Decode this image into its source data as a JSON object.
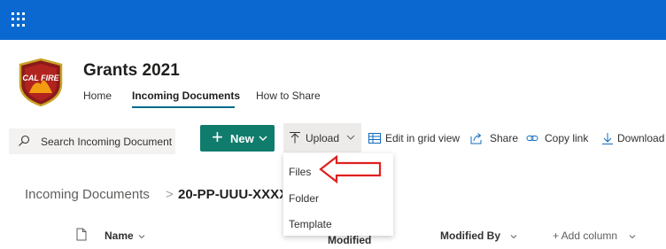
{
  "suite_bar": {
    "app_launcher_icon": "waffle-icon",
    "color": "#0a68d0"
  },
  "site": {
    "logo_icon": "cal-fire-logo",
    "logo_text": "CAL FIRE",
    "title": "Grants 2021",
    "nav": [
      {
        "label": "Home",
        "selected": false
      },
      {
        "label": "Incoming Documents",
        "selected": true
      },
      {
        "label": "How to Share",
        "selected": false
      }
    ]
  },
  "command_bar": {
    "search_placeholder": "Search Incoming Document",
    "new_label": "New",
    "upload_label": "Upload",
    "edit_grid_label": "Edit in grid view",
    "share_label": "Share",
    "copy_link_label": "Copy link",
    "download_label": "Download"
  },
  "upload_menu": {
    "items": [
      "Files",
      "Folder",
      "Template"
    ],
    "highlighted_item": "Files",
    "annotation": "red-arrow"
  },
  "breadcrumb": {
    "root": "Incoming Documents",
    "separator": ">",
    "current": "20-PP-UUU-XXXX"
  },
  "columns": {
    "file_type_icon": "document-icon",
    "name": "Name",
    "modified": "Modified",
    "modified_by": "Modified By",
    "add_column": "+ Add column"
  },
  "colors": {
    "accent": "#107c6c",
    "nav_underline": "#006b8a",
    "annotation_arrow": "#e02020"
  }
}
